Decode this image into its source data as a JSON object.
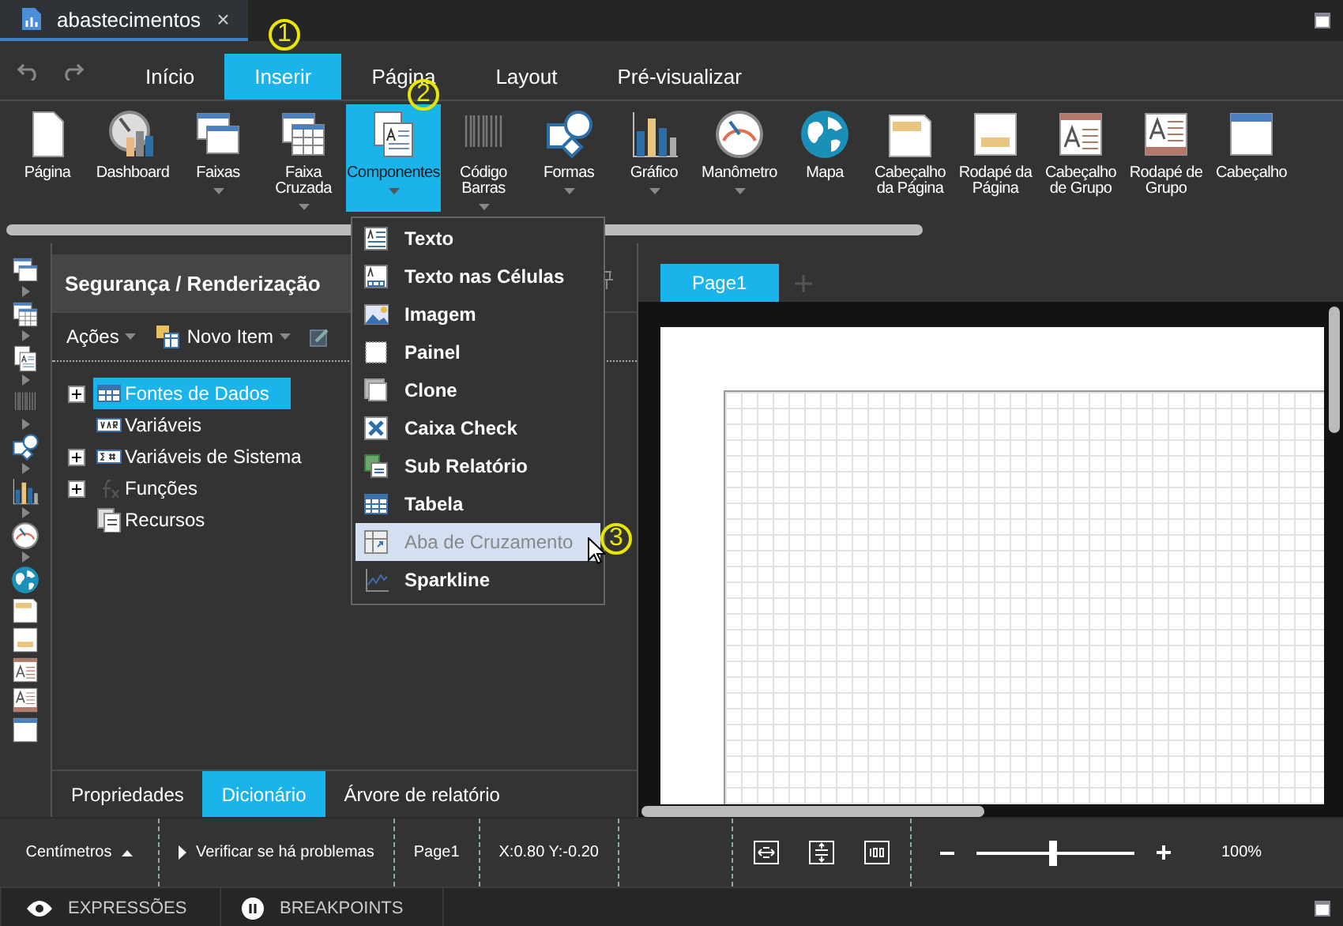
{
  "document_tab": {
    "title": "abastecimentos",
    "close": "×"
  },
  "ribbon_tabs": [
    {
      "label": "Início",
      "selected": false
    },
    {
      "label": "Inserir",
      "selected": true
    },
    {
      "label": "Página",
      "selected": false
    },
    {
      "label": "Layout",
      "selected": false
    },
    {
      "label": "Pré-visualizar",
      "selected": false
    }
  ],
  "ribbon_items": [
    {
      "label": "Página",
      "dropdown": false,
      "selected": false
    },
    {
      "label": "Dashboard",
      "dropdown": false,
      "selected": false
    },
    {
      "label": "Faixas",
      "dropdown": true,
      "selected": false
    },
    {
      "label": "Faixa Cruzada",
      "dropdown": true,
      "selected": false
    },
    {
      "label": "Componentes",
      "dropdown": true,
      "selected": true
    },
    {
      "label": "Código Barras",
      "dropdown": true,
      "selected": false
    },
    {
      "label": "Formas",
      "dropdown": true,
      "selected": false
    },
    {
      "label": "Gráfico",
      "dropdown": true,
      "selected": false
    },
    {
      "label": "Manômetro",
      "dropdown": true,
      "selected": false
    },
    {
      "label": "Mapa",
      "dropdown": false,
      "selected": false
    },
    {
      "label": "Cabeçalho da Página",
      "dropdown": false,
      "selected": false
    },
    {
      "label": "Rodapé da Página",
      "dropdown": false,
      "selected": false
    },
    {
      "label": "Cabeçalho de Grupo",
      "dropdown": false,
      "selected": false
    },
    {
      "label": "Rodapé de Grupo",
      "dropdown": false,
      "selected": false
    },
    {
      "label": "Cabeçalho",
      "dropdown": false,
      "selected": false
    }
  ],
  "panel": {
    "title": "Segurança / Renderização",
    "actions": [
      {
        "label": "Ações"
      },
      {
        "label": "Novo Item"
      }
    ],
    "tree": [
      {
        "label": "Fontes de Dados",
        "kind": "folder",
        "expanded": false,
        "selected": true
      },
      {
        "label": "Variáveis",
        "kind": "item",
        "selected": false
      },
      {
        "label": "Variáveis de Sistema",
        "kind": "folder",
        "expanded": false,
        "selected": false
      },
      {
        "label": "Funções",
        "kind": "folder",
        "expanded": false,
        "selected": false
      },
      {
        "label": "Recursos",
        "kind": "item",
        "selected": false
      }
    ],
    "tabs": [
      {
        "label": "Propriedades",
        "selected": false
      },
      {
        "label": "Dicionário",
        "selected": true
      },
      {
        "label": "Árvore de relatório",
        "selected": false
      }
    ]
  },
  "components_menu": [
    {
      "label": "Texto",
      "selected": false
    },
    {
      "label": "Texto nas Células",
      "selected": false
    },
    {
      "label": "Imagem",
      "selected": false
    },
    {
      "label": "Painel",
      "selected": false
    },
    {
      "label": "Clone",
      "selected": false
    },
    {
      "label": "Caixa Check",
      "selected": false
    },
    {
      "label": "Sub Relatório",
      "selected": false
    },
    {
      "label": "Tabela",
      "selected": false
    },
    {
      "label": "Aba de Cruzamento",
      "selected": true
    },
    {
      "label": "Sparkline",
      "selected": false
    }
  ],
  "page_tabs": [
    {
      "label": "Page1",
      "selected": true
    }
  ],
  "status_bar": {
    "units": "Centímetros",
    "check": "Verificar se há problemas",
    "page": "Page1",
    "position": "X:0.80 Y:-0.20",
    "zoom": {
      "level": 0.48
    },
    "zoom_reading": "100%"
  },
  "bottom_bar": [
    {
      "label": "EXPRESSÕES"
    },
    {
      "label": "BREAKPOINTS"
    }
  ],
  "callouts": [
    "1",
    "2",
    "3"
  ]
}
